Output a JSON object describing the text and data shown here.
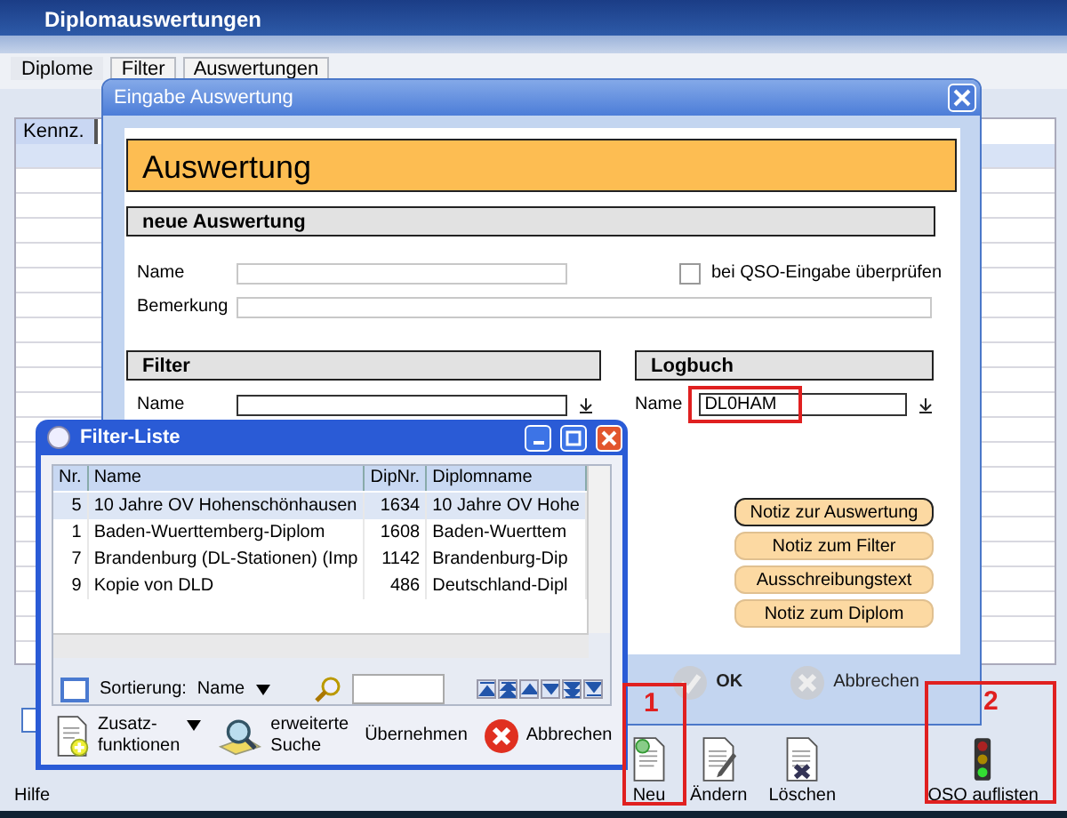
{
  "main_window": {
    "title": "Diplomauswertungen",
    "tabs": [
      {
        "label": "Diplome",
        "selected": true
      },
      {
        "label": "Filter",
        "selected": false
      },
      {
        "label": "Auswertungen",
        "selected": false
      }
    ],
    "list": {
      "columns": [
        "Kennz."
      ]
    },
    "toolbar": [
      {
        "kind": "new",
        "label": "Neu"
      },
      {
        "kind": "edit",
        "label": "Ändern"
      },
      {
        "kind": "delete",
        "label": "Löschen"
      },
      {
        "kind": "qso",
        "label": "QSO auflisten"
      }
    ],
    "help": "Hilfe"
  },
  "dialog": {
    "title": "Eingabe Auswertung",
    "header": "Auswertung",
    "new_section": {
      "title": "neue Auswertung",
      "name_label": "Name",
      "remark_label": "Bemerkung"
    },
    "check": {
      "label": "bei QSO-Eingabe überprüfen",
      "checked": false
    },
    "filter": {
      "title": "Filter",
      "name_label": "Name"
    },
    "logbook": {
      "title": "Logbuch",
      "name_label": "Name",
      "value": "DL0HAM"
    },
    "note_buttons": [
      {
        "label": "Notiz zur Auswertung",
        "selected": true
      },
      {
        "label": "Notiz zum Filter",
        "selected": false
      },
      {
        "label": "Ausschreibungstext",
        "selected": false
      },
      {
        "label": "Notiz zum Diplom",
        "selected": false
      }
    ],
    "buttons": [
      "OK",
      "Abbrechen"
    ]
  },
  "filter_list": {
    "title": "Filter-Liste",
    "columns": [
      "Nr.",
      "Name",
      "DipNr.",
      "Diplomname"
    ],
    "rows": [
      {
        "cells": [
          "5",
          "10 Jahre OV Hohenschönhausen",
          "1634",
          "10 Jahre OV Hohe"
        ],
        "selected": true
      },
      {
        "cells": [
          "1",
          "Baden-Wuerttemberg-Diplom",
          "1608",
          "Baden-Wuerttem"
        ],
        "selected": false
      },
      {
        "cells": [
          "7",
          "Brandenburg (DL-Stationen) (Imp",
          "1142",
          "Brandenburg-Dip"
        ],
        "selected": false
      },
      {
        "cells": [
          "9",
          "Kopie von DLD",
          "486",
          "Deutschland-Dipl"
        ],
        "selected": false
      }
    ],
    "sort_label": "Sortierung:",
    "sort_value": "Name",
    "buttons": [
      {
        "kind": "extra",
        "label": "Zusatz-",
        "label_2": "funktionen"
      },
      {
        "kind": "search",
        "label": "erweiterte",
        "label_2": "Suche"
      },
      {
        "kind": "apply",
        "label": "Übernehmen"
      },
      {
        "kind": "cancel",
        "label": "Abbrechen"
      }
    ]
  },
  "annotations": [
    {
      "kind": "box"
    },
    {
      "kind": "numbered",
      "label": "1"
    },
    {
      "kind": "numbered",
      "label": "2"
    }
  ]
}
